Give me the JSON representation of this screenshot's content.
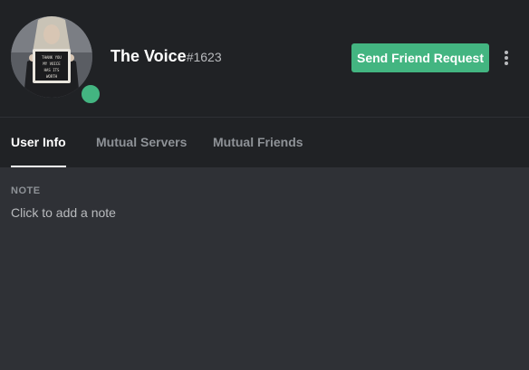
{
  "profile": {
    "username": "The Voice",
    "discriminator": "#1623",
    "status": "online",
    "status_color": "#43b581",
    "avatar_sign_text": [
      "THANK YOU",
      "MY VOICE",
      "HAS ITS",
      "WORTH"
    ]
  },
  "actions": {
    "send_friend_request_label": "Send Friend Request",
    "more_icon": "more-vertical-icon"
  },
  "tabs": [
    {
      "label": "User Info",
      "active": true
    },
    {
      "label": "Mutual Servers",
      "active": false
    },
    {
      "label": "Mutual Friends",
      "active": false
    }
  ],
  "user_info": {
    "note_label": "NOTE",
    "note_placeholder": "Click to add a note"
  },
  "colors": {
    "accent_green": "#43b581",
    "header_bg": "#202225",
    "body_bg": "#2f3136"
  }
}
